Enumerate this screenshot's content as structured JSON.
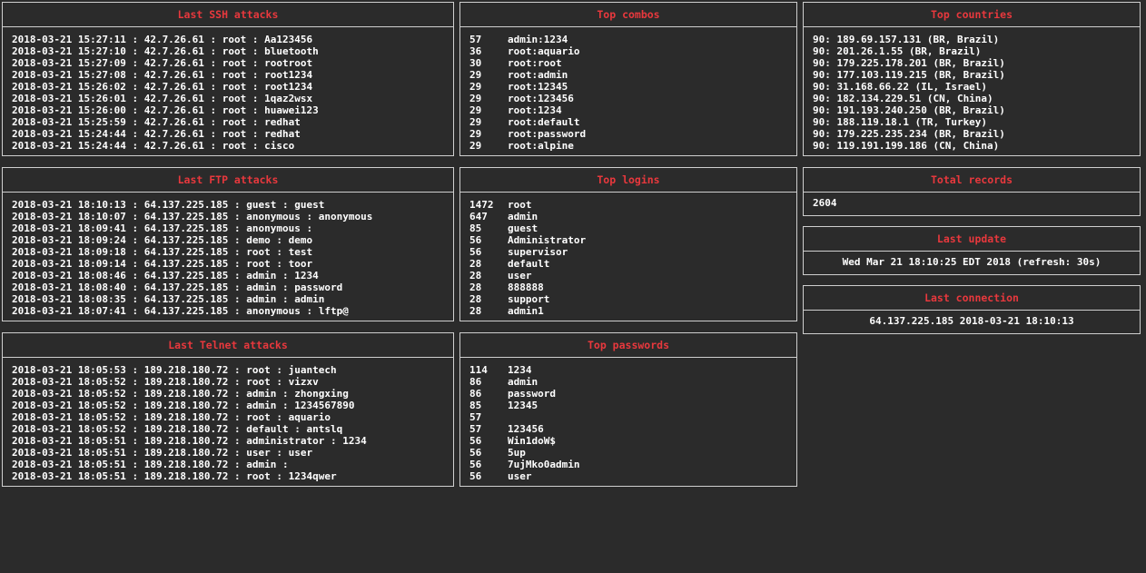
{
  "ssh": {
    "title": "Last SSH attacks",
    "rows": [
      "2018-03-21 15:27:11 : 42.7.26.61 : root : Aa123456",
      "2018-03-21 15:27:10 : 42.7.26.61 : root : bluetooth",
      "2018-03-21 15:27:09 : 42.7.26.61 : root : rootroot",
      "2018-03-21 15:27:08 : 42.7.26.61 : root : root1234",
      "2018-03-21 15:26:02 : 42.7.26.61 : root : root1234",
      "2018-03-21 15:26:01 : 42.7.26.61 : root : 1qaz2wsx",
      "2018-03-21 15:26:00 : 42.7.26.61 : root : huawei123",
      "2018-03-21 15:25:59 : 42.7.26.61 : root : redhat",
      "2018-03-21 15:24:44 : 42.7.26.61 : root : redhat",
      "2018-03-21 15:24:44 : 42.7.26.61 : root : cisco"
    ]
  },
  "combos": {
    "title": "Top combos",
    "rows": [
      {
        "count": "57",
        "value": "admin:1234"
      },
      {
        "count": "36",
        "value": "root:aquario"
      },
      {
        "count": "30",
        "value": "root:root"
      },
      {
        "count": "29",
        "value": "root:admin"
      },
      {
        "count": "29",
        "value": "root:12345"
      },
      {
        "count": "29",
        "value": "root:123456"
      },
      {
        "count": "29",
        "value": "root:1234"
      },
      {
        "count": "29",
        "value": "root:default"
      },
      {
        "count": "29",
        "value": "root:password"
      },
      {
        "count": "29",
        "value": "root:alpine"
      }
    ]
  },
  "countries": {
    "title": "Top countries",
    "rows": [
      "90: 189.69.157.131 (BR, Brazil)",
      "90: 201.26.1.55 (BR, Brazil)",
      "90: 179.225.178.201 (BR, Brazil)",
      "90: 177.103.119.215 (BR, Brazil)",
      "90: 31.168.66.22 (IL, Israel)",
      "90: 182.134.229.51 (CN, China)",
      "90: 191.193.240.250 (BR, Brazil)",
      "90: 188.119.18.1 (TR, Turkey)",
      "90: 179.225.235.234 (BR, Brazil)",
      "90: 119.191.199.186 (CN, China)"
    ]
  },
  "ftp": {
    "title": "Last FTP attacks",
    "rows": [
      "2018-03-21 18:10:13 : 64.137.225.185 : guest : guest",
      "2018-03-21 18:10:07 : 64.137.225.185 : anonymous : anonymous",
      "2018-03-21 18:09:41 : 64.137.225.185 : anonymous :",
      "2018-03-21 18:09:24 : 64.137.225.185 : demo : demo",
      "2018-03-21 18:09:18 : 64.137.225.185 : root : test",
      "2018-03-21 18:09:14 : 64.137.225.185 : root : toor",
      "2018-03-21 18:08:46 : 64.137.225.185 : admin : 1234",
      "2018-03-21 18:08:40 : 64.137.225.185 : admin : password",
      "2018-03-21 18:08:35 : 64.137.225.185 : admin : admin",
      "2018-03-21 18:07:41 : 64.137.225.185 : anonymous : lftp@"
    ]
  },
  "logins": {
    "title": "Top logins",
    "rows": [
      {
        "count": "1472",
        "value": "root"
      },
      {
        "count": "647",
        "value": "admin"
      },
      {
        "count": "85",
        "value": "guest"
      },
      {
        "count": "56",
        "value": "Administrator"
      },
      {
        "count": "56",
        "value": "supervisor"
      },
      {
        "count": "28",
        "value": "default"
      },
      {
        "count": "28",
        "value": "user"
      },
      {
        "count": "28",
        "value": "888888"
      },
      {
        "count": "28",
        "value": "support"
      },
      {
        "count": "28",
        "value": "admin1"
      }
    ]
  },
  "total": {
    "title": "Total records",
    "value": "2604"
  },
  "last_update": {
    "title": "Last update",
    "value": "Wed Mar 21 18:10:25 EDT 2018 (refresh: 30s)"
  },
  "last_connection": {
    "title": "Last connection",
    "value": "64.137.225.185 2018-03-21 18:10:13"
  },
  "telnet": {
    "title": "Last Telnet attacks",
    "rows": [
      "2018-03-21 18:05:53 : 189.218.180.72 : root : juantech",
      "2018-03-21 18:05:52 : 189.218.180.72 : root : vizxv",
      "2018-03-21 18:05:52 : 189.218.180.72 : admin : zhongxing",
      "2018-03-21 18:05:52 : 189.218.180.72 : admin : 1234567890",
      "2018-03-21 18:05:52 : 189.218.180.72 : root : aquario",
      "2018-03-21 18:05:52 : 189.218.180.72 : default : antslq",
      "2018-03-21 18:05:51 : 189.218.180.72 : administrator : 1234",
      "2018-03-21 18:05:51 : 189.218.180.72 : user : user",
      "2018-03-21 18:05:51 : 189.218.180.72 : admin :",
      "2018-03-21 18:05:51 : 189.218.180.72 : root : 1234qwer"
    ]
  },
  "passwords": {
    "title": "Top passwords",
    "rows": [
      {
        "count": "114",
        "value": "1234"
      },
      {
        "count": "86",
        "value": "admin"
      },
      {
        "count": "86",
        "value": "password"
      },
      {
        "count": "85",
        "value": "12345"
      },
      {
        "count": "57",
        "value": ""
      },
      {
        "count": "57",
        "value": "123456"
      },
      {
        "count": "56",
        "value": "Win1doW$"
      },
      {
        "count": "56",
        "value": "5up"
      },
      {
        "count": "56",
        "value": "7ujMko0admin"
      },
      {
        "count": "56",
        "value": "user"
      }
    ]
  }
}
